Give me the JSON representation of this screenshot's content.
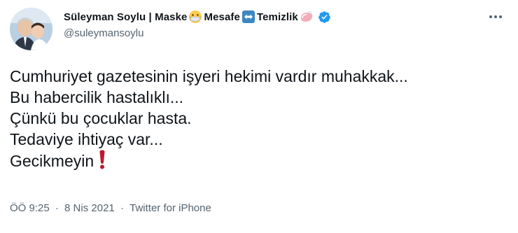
{
  "tweet": {
    "name_part1": "Süleyman Soylu | Maske",
    "name_part2": "Mesafe",
    "name_part3": "Temizlik",
    "handle": "@suleymansoylu",
    "lines": [
      "Cumhuriyet gazetesinin işyeri hekimi vardır muhakkak...",
      "Bu habercilik hastalıklı...",
      "Çünkü bu çocuklar hasta.",
      "Tedaviye ihtiyaç var...",
      "Gecikmeyin"
    ],
    "time": "ÖÖ 9:25",
    "separator1": "·",
    "date": "8 Nis 2021",
    "separator2": "·",
    "source": "Twitter for iPhone",
    "icons": {
      "mask": "mask-emoji-icon",
      "arrows": "left-right-arrow-emoji-icon",
      "soap": "soap-emoji-icon",
      "verified": "verified-badge-icon",
      "exclamation": "red-exclamation-emoji-icon",
      "more": "more-options-icon"
    },
    "colors": {
      "text": "#0f1419",
      "secondary": "#536471",
      "verified": "#1d9bf0",
      "exclamation": "#be1931"
    }
  }
}
